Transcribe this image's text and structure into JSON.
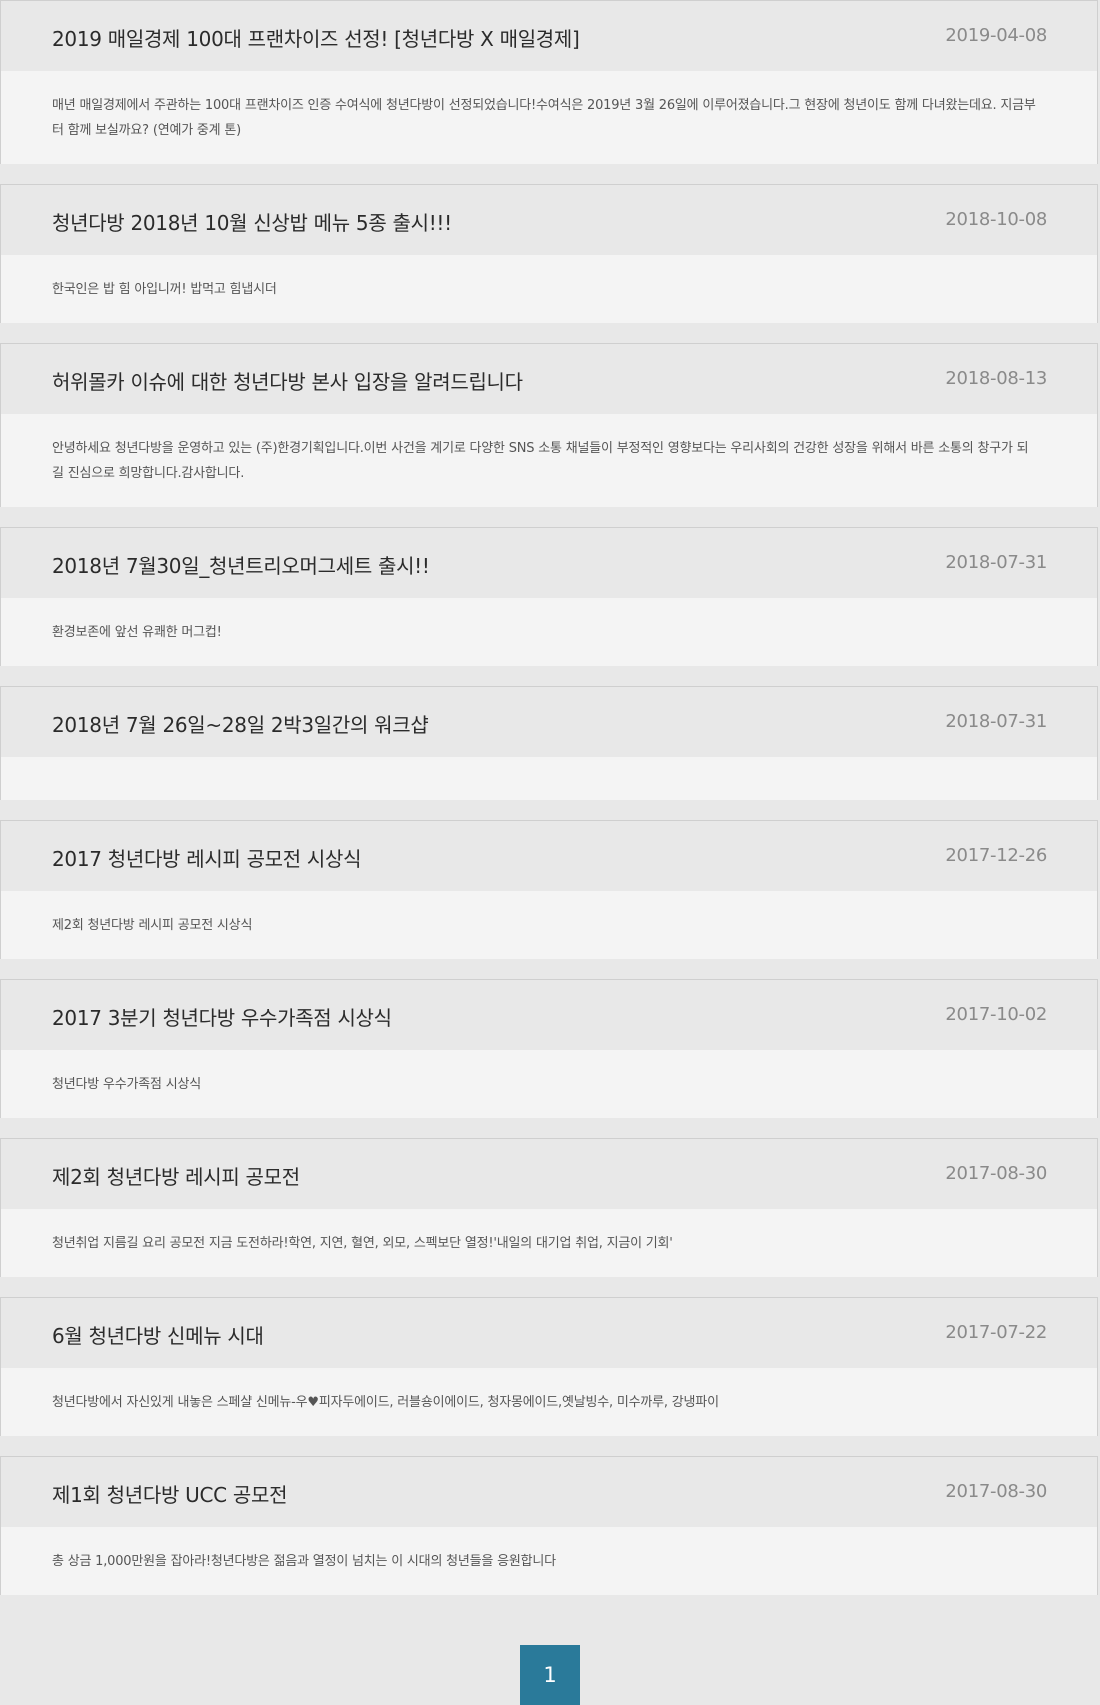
{
  "notices": [
    {
      "title": "2019 매일경제 100대 프랜차이즈 선정! [청년다방 X 매일경제]",
      "date": "2019-04-08",
      "body": "매년 매일경제에서 주관하는 100대 프랜차이즈 인증 수여식에 청년다방이 선정되었습니다!수여식은 2019년 3월 26일에 이루어졌습니다.그 현장에 청년이도 함께 다녀왔는데요. 지금부터 함께 보실까요? (연예가 중계 톤)"
    },
    {
      "title": "청년다방 2018년 10월 신상밥 메뉴 5종 출시!!!",
      "date": "2018-10-08",
      "body": "한국인은 밥 힘 아입니꺼! 밥먹고 힘냅시더"
    },
    {
      "title": "허위몰카 이슈에 대한 청년다방 본사 입장을 알려드립니다",
      "date": "2018-08-13",
      "body": "안녕하세요 청년다방을 운영하고 있는 (주)한경기획입니다.이번 사건을 계기로 다양한 SNS 소통 채널들이 부정적인 영향보다는 우리사회의 건강한 성장을 위해서 바른 소통의 창구가 되길 진심으로 희망합니다.감사합니다."
    },
    {
      "title": "2018년 7월30일_청년트리오머그세트 출시!!",
      "date": "2018-07-31",
      "body": "환경보존에 앞선 유쾌한 머그컵!"
    },
    {
      "title": "2018년 7월 26일~28일 2박3일간의 워크샵",
      "date": "2018-07-31",
      "body": ""
    },
    {
      "title": "2017 청년다방 레시피 공모전 시상식",
      "date": "2017-12-26",
      "body": "제2회 청년다방 레시피 공모전 시상식"
    },
    {
      "title": "2017 3분기 청년다방 우수가족점 시상식",
      "date": "2017-10-02",
      "body": "청년다방 우수가족점 시상식"
    },
    {
      "title": "제2회 청년다방 레시피 공모전",
      "date": "2017-08-30",
      "body": "청년취업 지름길 요리 공모전 지금 도전하라!학연, 지연, 혈연, 외모, 스펙보단 열정!'내일의 대기업 취업, 지금이 기회'"
    },
    {
      "title": "6월 청년다방 신메뉴 시대",
      "date": "2017-07-22",
      "body": "청년다방에서 자신있게 내놓은 스페샬 신메뉴-우♥피자두에이드, 러블숑이에이드, 청자몽에이드,옛날빙수, 미수까루, 강냉파이"
    },
    {
      "title": "제1회 청년다방 UCC 공모전",
      "date": "2017-08-30",
      "body": "총 상금 1,000만원을 잡아라!청년다방은 젊음과 열정이 넘치는 이 시대의 청년들을 응원합니다"
    }
  ],
  "pagination": {
    "current_page": "1"
  },
  "colors": {
    "page_background": "#e8e8e8",
    "header_background": "#e8e8e8",
    "body_background": "#f4f4f4",
    "pagination_active": "#2a7a9a"
  }
}
